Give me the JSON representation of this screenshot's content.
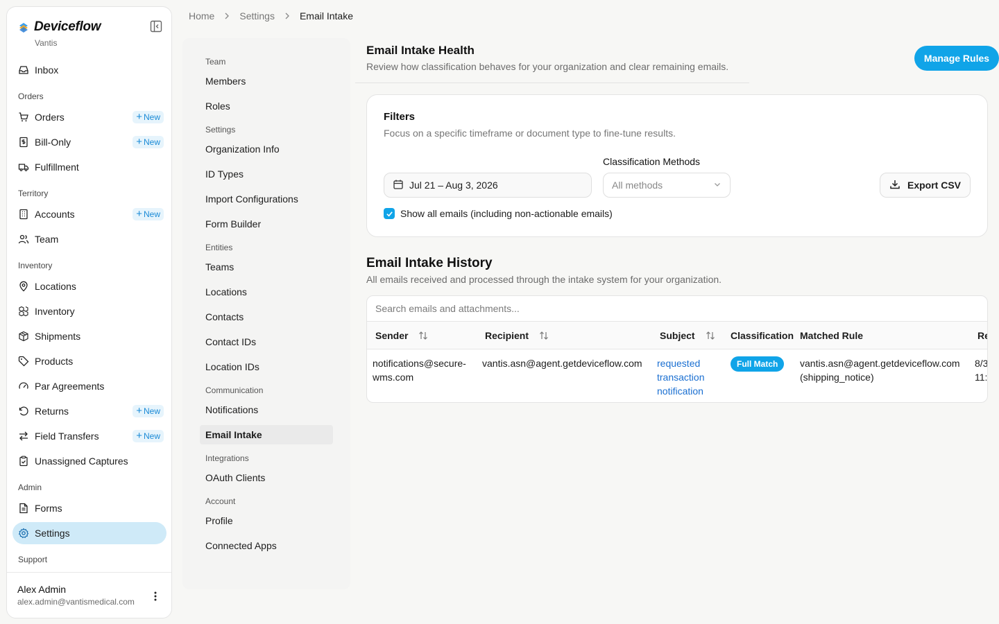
{
  "app": {
    "name": "Deviceflow",
    "org": "Vantis"
  },
  "sidebar": {
    "items": [
      {
        "type": "item",
        "label": "Inbox",
        "icon": "inbox-icon",
        "name": "sidebar-item-inbox"
      },
      {
        "type": "section",
        "label": "Orders"
      },
      {
        "type": "item",
        "label": "Orders",
        "icon": "cart-icon",
        "name": "sidebar-item-orders",
        "badge": "New"
      },
      {
        "type": "item",
        "label": "Bill-Only",
        "icon": "receipt-icon",
        "name": "sidebar-item-bill-only",
        "badge": "New"
      },
      {
        "type": "item",
        "label": "Fulfillment",
        "icon": "truck-icon",
        "name": "sidebar-item-fulfillment"
      },
      {
        "type": "section",
        "label": "Territory"
      },
      {
        "type": "item",
        "label": "Accounts",
        "icon": "building-icon",
        "name": "sidebar-item-accounts",
        "badge": "New"
      },
      {
        "type": "item",
        "label": "Team",
        "icon": "users-icon",
        "name": "sidebar-item-team"
      },
      {
        "type": "section",
        "label": "Inventory"
      },
      {
        "type": "item",
        "label": "Locations",
        "icon": "map-pin-icon",
        "name": "sidebar-item-locations"
      },
      {
        "type": "item",
        "label": "Inventory",
        "icon": "boxes-icon",
        "name": "sidebar-item-inventory"
      },
      {
        "type": "item",
        "label": "Shipments",
        "icon": "package-icon",
        "name": "sidebar-item-shipments"
      },
      {
        "type": "item",
        "label": "Products",
        "icon": "tag-icon",
        "name": "sidebar-item-products"
      },
      {
        "type": "item",
        "label": "Par Agreements",
        "icon": "gauge-icon",
        "name": "sidebar-item-par-agreements"
      },
      {
        "type": "item",
        "label": "Returns",
        "icon": "rotate-ccw-icon",
        "name": "sidebar-item-returns",
        "badge": "New"
      },
      {
        "type": "item",
        "label": "Field Transfers",
        "icon": "arrows-transfer-icon",
        "name": "sidebar-item-field-transfers",
        "badge": "New"
      },
      {
        "type": "item",
        "label": "Unassigned Captures",
        "icon": "clipboard-check-icon",
        "name": "sidebar-item-unassigned-captures"
      },
      {
        "type": "section",
        "label": "Admin"
      },
      {
        "type": "item",
        "label": "Forms",
        "icon": "file-text-icon",
        "name": "sidebar-item-forms"
      },
      {
        "type": "item",
        "label": "Settings",
        "icon": "gear-icon",
        "name": "sidebar-item-settings",
        "active": true
      },
      {
        "type": "section",
        "label": "Support"
      }
    ],
    "user": {
      "name": "Alex Admin",
      "email": "alex.admin@vantismedical.com"
    }
  },
  "breadcrumb": {
    "home": "Home",
    "settings": "Settings",
    "current": "Email Intake"
  },
  "subnav": {
    "groups": [
      {
        "section": "Team",
        "items": [
          "Members",
          "Roles"
        ]
      },
      {
        "section": "Settings",
        "items": [
          "Organization Info",
          "ID Types",
          "Import Configurations",
          "Form Builder"
        ]
      },
      {
        "section": "Entities",
        "items": [
          "Teams",
          "Locations",
          "Contacts",
          "Contact IDs",
          "Location IDs"
        ]
      },
      {
        "section": "Communication",
        "items": [
          "Notifications",
          "Email Intake"
        ]
      },
      {
        "section": "Integrations",
        "items": [
          "OAuth Clients"
        ]
      },
      {
        "section": "Account",
        "items": [
          "Profile",
          "Connected Apps"
        ]
      }
    ],
    "active": "Email Intake"
  },
  "health": {
    "title": "Email Intake Health",
    "description": "Review how classification behaves for your organization and clear remaining emails.",
    "manage_label": "Manage Rules"
  },
  "filters": {
    "title": "Filters",
    "description": "Focus on a specific timeframe or document type to fine-tune results.",
    "date_range": "Jul 21 – Aug 3, 2026",
    "methods_label": "Classification Methods",
    "methods_value": "All methods",
    "export_label": "Export CSV",
    "show_all_label": "Show all emails (including non-actionable emails)",
    "show_all_checked": true
  },
  "history": {
    "title": "Email Intake History",
    "description": "All emails received and processed through the intake system for your organization.",
    "search_placeholder": "Search emails and attachments...",
    "columns": [
      "Sender",
      "Recipient",
      "Subject",
      "Classification",
      "Matched Rule",
      "Re"
    ],
    "rows": [
      {
        "sender": "notifications@secure-wms.com",
        "recipient": "vantis.asn@agent.getdeviceflow.com",
        "subject": "requested transaction notification",
        "classification": "Full Match",
        "matched_rule": "vantis.asn@agent.getdeviceflow.com (shipping_notice)",
        "received": "8/3 11:0"
      }
    ]
  },
  "colors": {
    "accent": "#10a4e8",
    "active_nav": "#cfeaf8",
    "link": "#1a6fd1"
  }
}
